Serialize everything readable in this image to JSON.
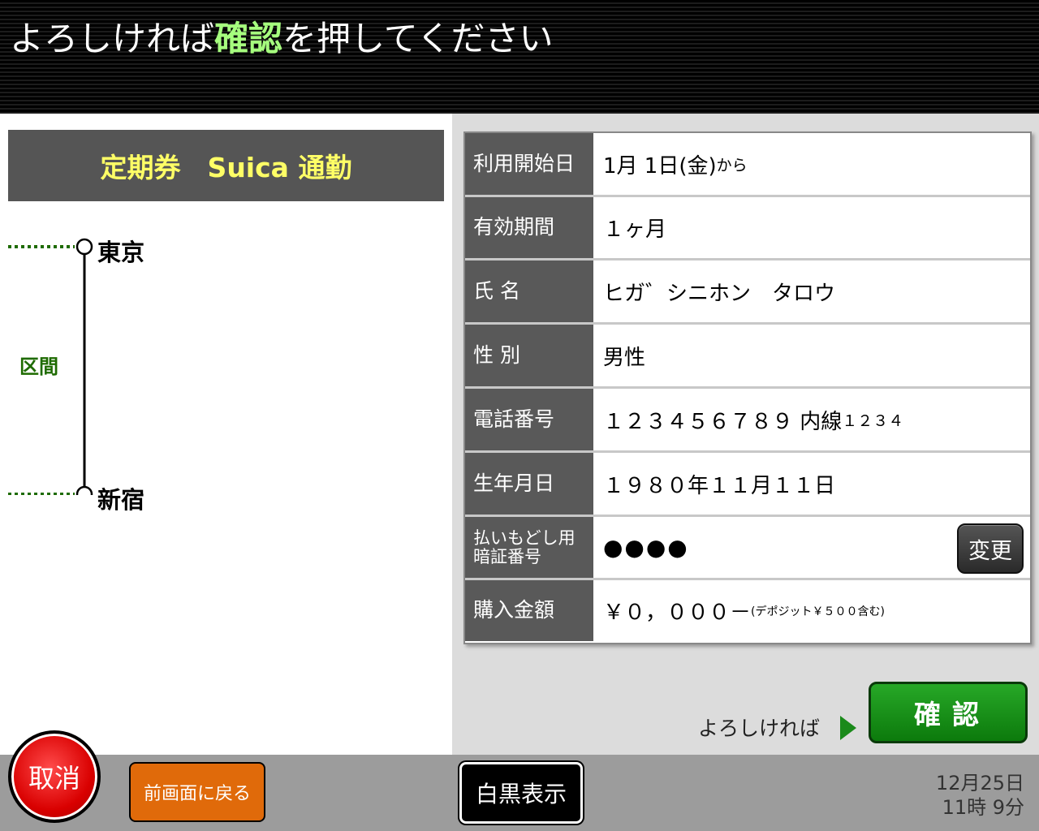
{
  "header": {
    "title_before": "よろしければ",
    "title_accent": "確認",
    "title_after": "を押してください"
  },
  "ticket": {
    "type_label": "定期券　Suica 通勤"
  },
  "route": {
    "from_station": "東京",
    "to_station": "新宿",
    "section_label": "区間"
  },
  "info": {
    "start_date": {
      "label": "利用開始日",
      "value": "1月 1日(金)",
      "suffix": "から"
    },
    "period": {
      "label": "有効期間",
      "value": "１ヶ月"
    },
    "name": {
      "label": "氏 名",
      "value": "ヒガ゛シニホン　タロウ"
    },
    "gender": {
      "label": "性 別",
      "value": "男性"
    },
    "phone": {
      "label": "電話番号",
      "value": "１２３４５６７８９ 内線",
      "ext": "１２３４"
    },
    "birthday": {
      "label": "生年月日",
      "value": "１９８０年１１月１１日"
    },
    "pin": {
      "label_line1": "払いもどし用",
      "label_line2": "暗証番号",
      "value": "●●●●",
      "change_label": "変更"
    },
    "amount": {
      "label": "購入金額",
      "value": "￥０，０００－",
      "note": "(デポジット￥５００含む)"
    }
  },
  "confirm": {
    "prompt": "よろしければ",
    "button_label": "確認"
  },
  "footer": {
    "cancel_label": "取消",
    "back_label": "前画面に戻る",
    "bw_label": "白黒表示",
    "date": "12月25日",
    "time": "11時  9分"
  },
  "colors": {
    "accent_green": "#a6ff7e",
    "ticket_yellow": "#ffff66",
    "confirm_green": "#1a961a",
    "cancel_red": "#d90000",
    "back_orange": "#e06a0a"
  }
}
